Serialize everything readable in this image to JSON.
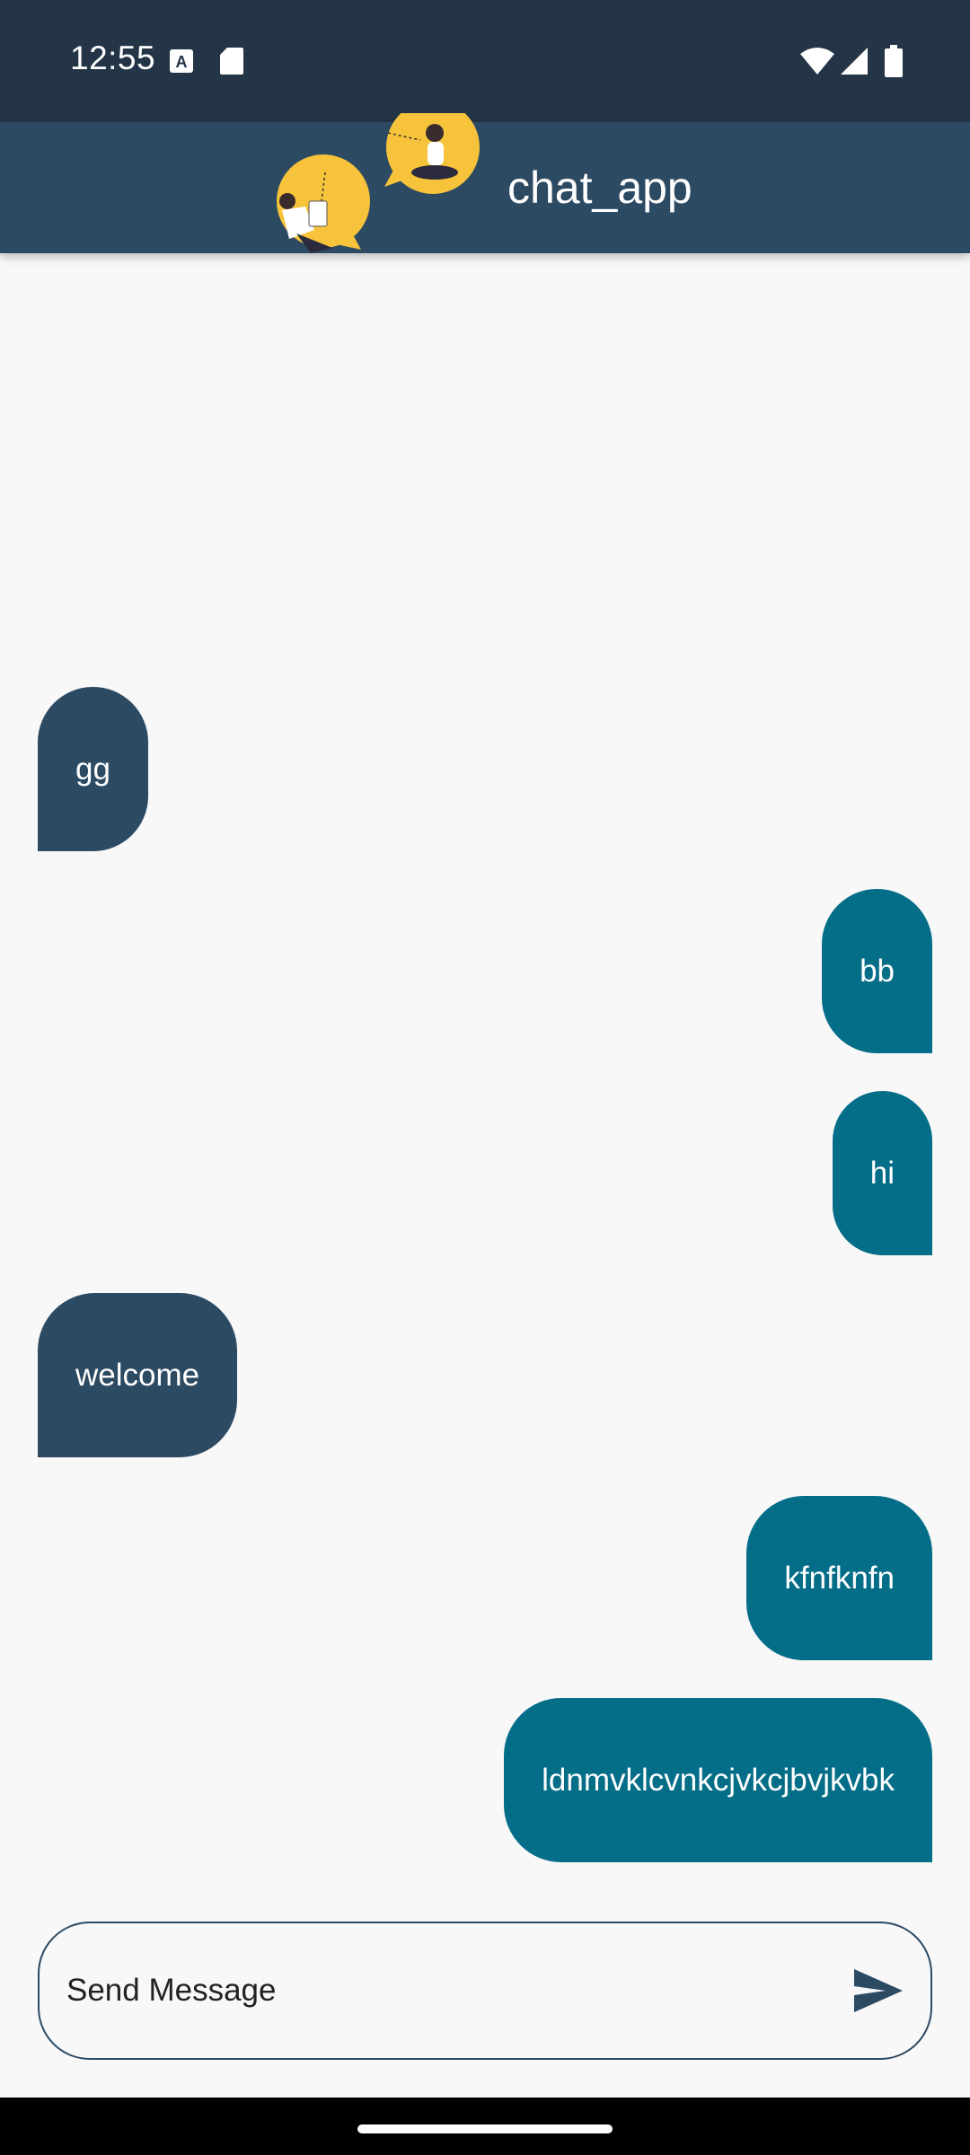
{
  "status_bar": {
    "time": "12:55",
    "left_icons": [
      "translate-icon",
      "sd-card-icon"
    ],
    "right_icons": [
      "wifi-icon",
      "signal-icon",
      "battery-icon"
    ]
  },
  "app_bar": {
    "title": "chat_app",
    "logo": "chat-illustration-logo",
    "color": "#2d4a63"
  },
  "messages": [
    {
      "text": "gg",
      "direction": "received"
    },
    {
      "text": "bb",
      "direction": "sent"
    },
    {
      "text": "hi",
      "direction": "sent"
    },
    {
      "text": "welcome",
      "direction": "received"
    },
    {
      "text": "kfnfknfn",
      "direction": "sent"
    },
    {
      "text": "ldnmvklcvnkcjvkcjbvjkvbk",
      "direction": "sent"
    }
  ],
  "colors": {
    "received_bubble": "#2d4a63",
    "sent_bubble": "#046d88",
    "status_bar": "#233547",
    "background": "#f8f8f9"
  },
  "composer": {
    "placeholder": "Send Message",
    "value": "",
    "send_icon": "send-icon"
  }
}
